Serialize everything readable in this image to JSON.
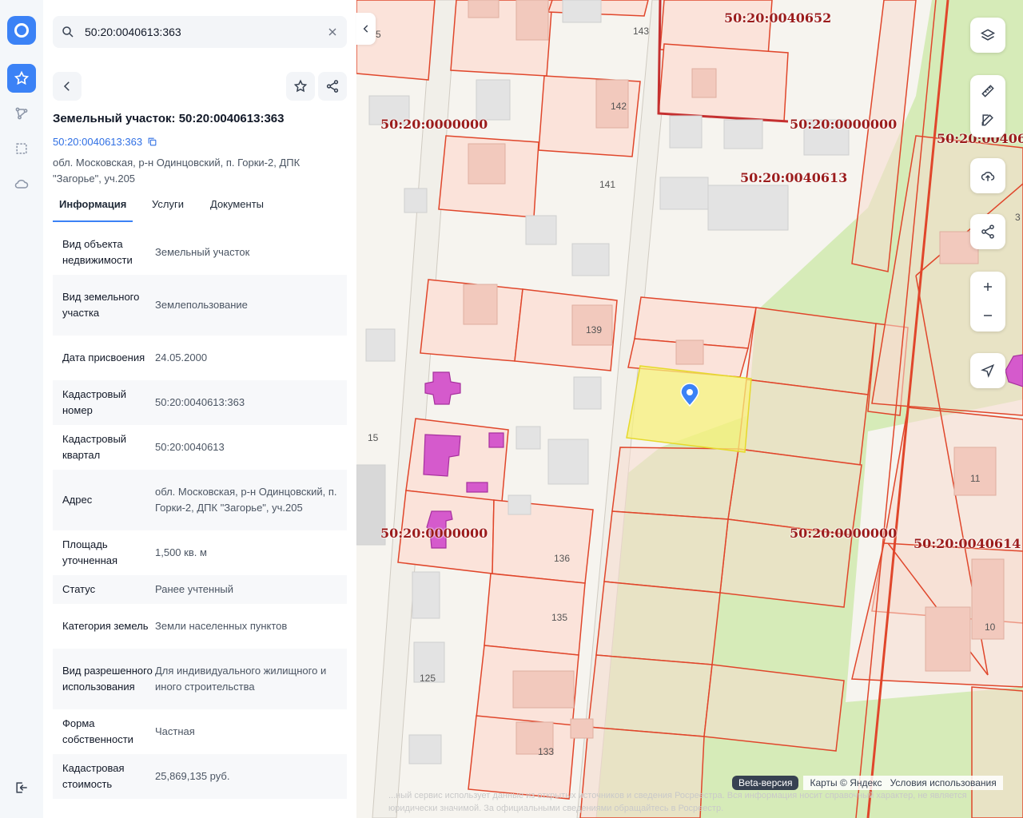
{
  "search": {
    "query": "50:20:0040613:363"
  },
  "object": {
    "title": "Земельный участок: 50:20:0040613:363",
    "cadastral_link": "50:20:0040613:363",
    "address_line": "обл. Московская, р-н Одинцовский, п. Горки-2, ДПК \"Загорье\", уч.205"
  },
  "tabs": [
    {
      "label": "Информация",
      "active": true
    },
    {
      "label": "Услуги",
      "active": false
    },
    {
      "label": "Документы",
      "active": false
    }
  ],
  "info_rows": [
    {
      "key": "Вид объекта недвижимости",
      "value": "Земельный участок"
    },
    {
      "key": "Вид земельного участка",
      "value": "Землепользование"
    },
    {
      "key": "Дата присвоения",
      "value": "24.05.2000"
    },
    {
      "key": "Кадастровый номер",
      "value": "50:20:0040613:363"
    },
    {
      "key": "Кадастровый квартал",
      "value": "50:20:0040613"
    },
    {
      "key": "Адрес",
      "value": "обл. Московская, р-н Одинцовский, п. Горки-2, ДПК \"Загорье\", уч.205"
    },
    {
      "key": "Площадь уточненная",
      "value": "1,500 кв. м"
    },
    {
      "key": "Статус",
      "value": "Ранее учтенный"
    },
    {
      "key": "Категория земель",
      "value": "Земли населенных пунктов"
    },
    {
      "key": "Вид разрешенного использования",
      "value": "Для индивидуального жилищного и иного строительства"
    },
    {
      "key": "Форма собственности",
      "value": "Частная"
    },
    {
      "key": "Кадастровая стоимость",
      "value": "25,869,135 руб."
    }
  ],
  "map": {
    "labels": [
      "50:20:0040652",
      "50:20:0000000",
      "50:20:0000000",
      "50:20:0040613",
      "50:20:00406",
      "50:20:0000000",
      "50:20:0000000",
      "50:20:0040614"
    ],
    "building_numbers": [
      "5",
      "143",
      "142",
      "141",
      "139",
      "15",
      "136",
      "135",
      "125",
      "133",
      "11",
      "10",
      "3"
    ],
    "attribution": {
      "beta": "Beta-версия",
      "maps": "Карты © Яндекс",
      "terms": "Условия использования"
    },
    "disclaimer": "...ный сервис использует данные из открытых источников и сведения Росреестра. Вся информация носит справочный характер, не является юридически значимой. За официальными сведениями обращайтесь в Росреестр."
  },
  "colors": {
    "accent": "#3b82f6",
    "parcel_border": "#e0462b",
    "parcel_fill": "#fbe3da",
    "selected_parcel": "#f7f07a",
    "green_zone": "#d4ecb4",
    "label_red": "#9b1c1c",
    "building_pink": "#d34ecb"
  }
}
